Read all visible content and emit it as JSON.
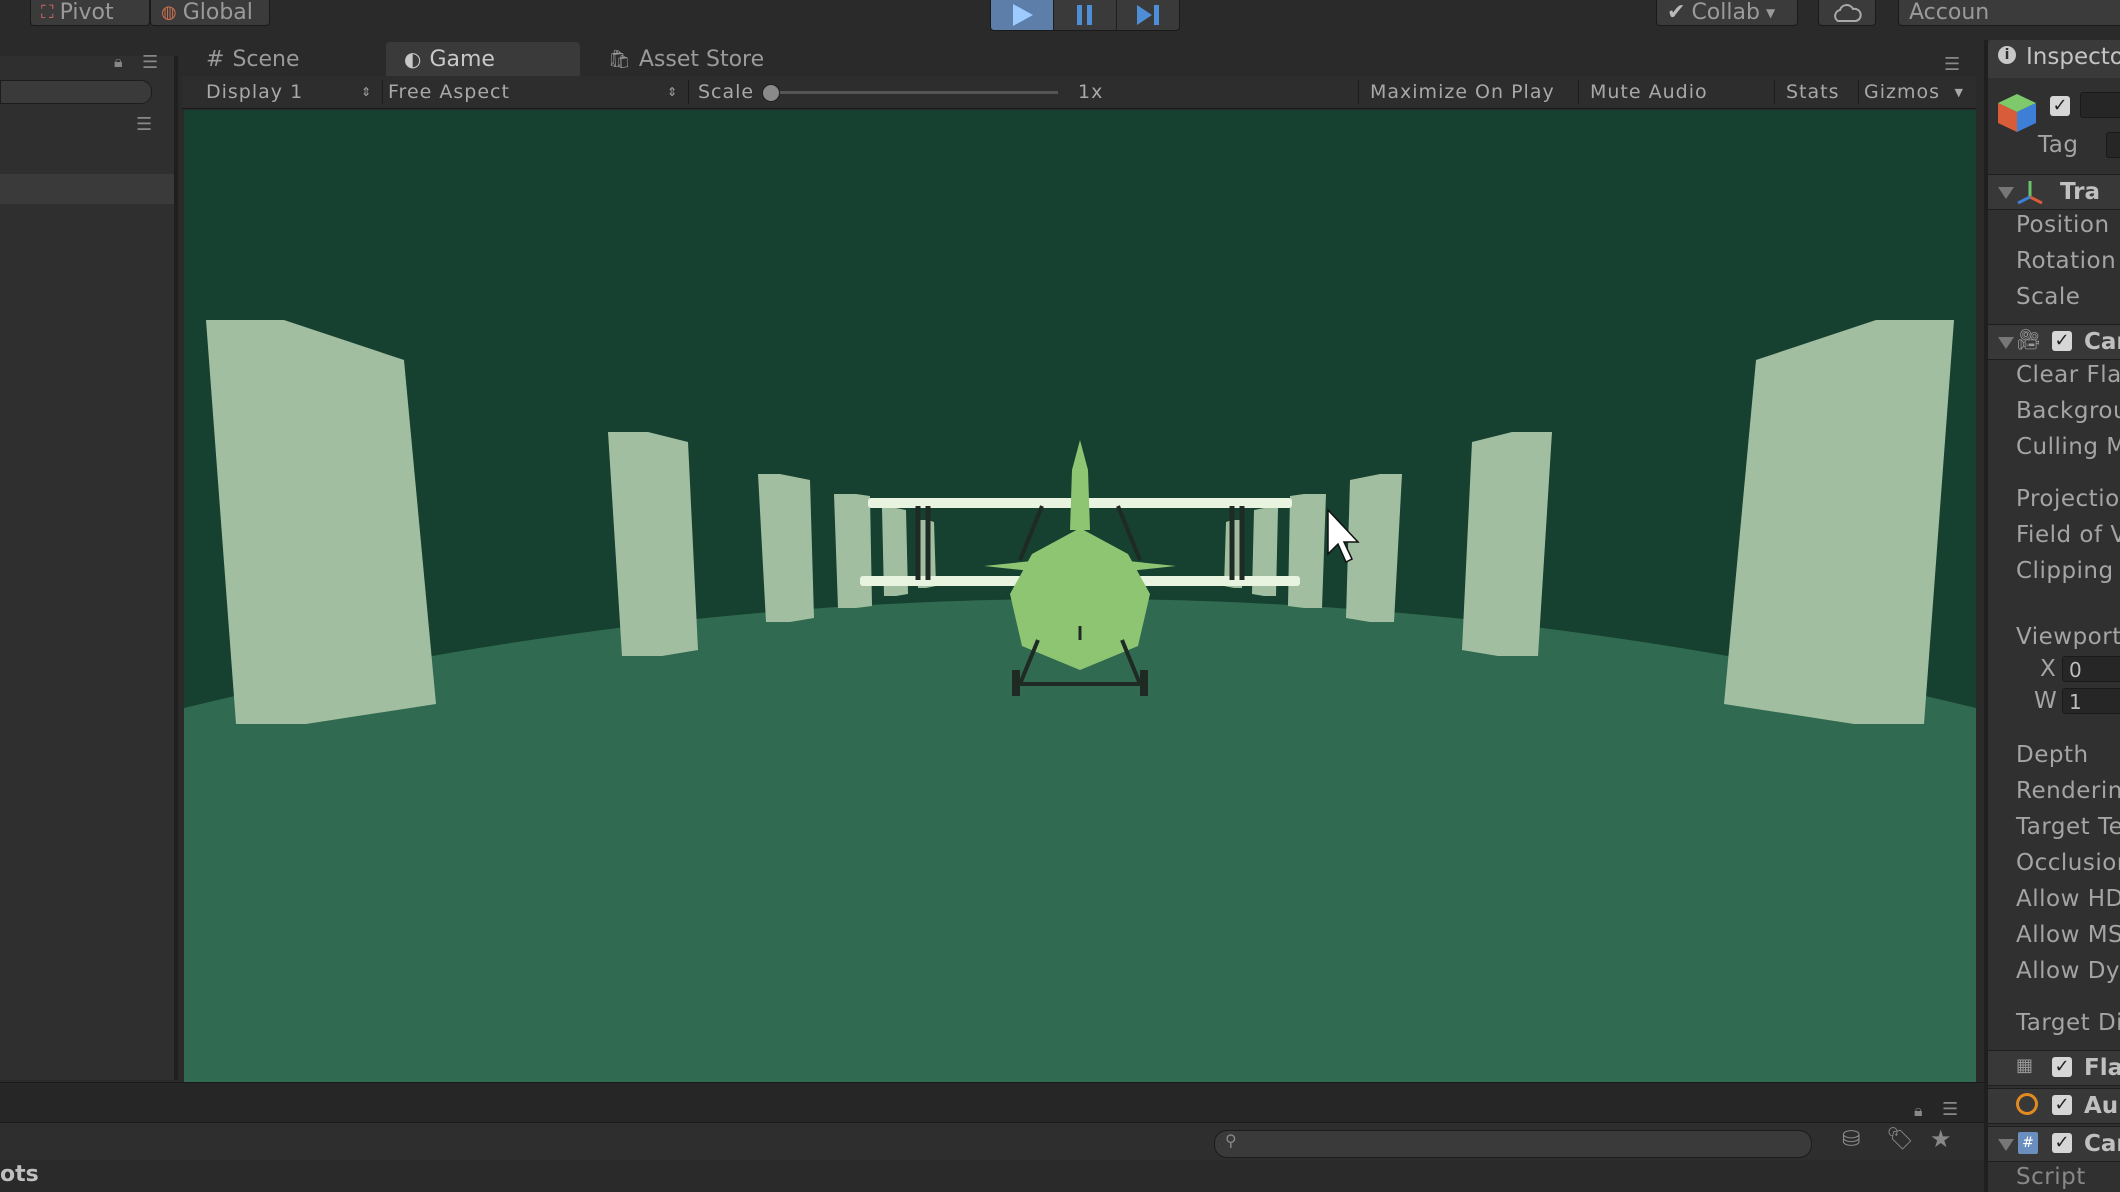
{
  "toolbar": {
    "pivot_label": "Pivot",
    "global_label": "Global",
    "collab_label": "Collab",
    "account_label": "Accoun"
  },
  "tabs": {
    "scene": "Scene",
    "game": "Game",
    "asset_store": "Asset Store"
  },
  "game_toolbar": {
    "display": "Display 1",
    "aspect": "Free Aspect",
    "scale_label": "Scale",
    "scale_value": "1x",
    "maximize_on_play": "Maximize On Play",
    "mute_audio": "Mute Audio",
    "stats": "Stats",
    "gizmos": "Gizmos"
  },
  "inspector": {
    "tab_label": "Inspecto",
    "tag_label": "Tag",
    "transform_title": "Tra",
    "transform_fields": [
      "Position",
      "Rotation",
      "Scale"
    ],
    "camera_title": "Car",
    "camera_fields_a": [
      "Clear Flac",
      "Backgrou",
      "Culling M"
    ],
    "camera_fields_b": [
      "Projectior",
      "Field of V",
      "Clipping F"
    ],
    "viewport_label": "Viewport",
    "viewport_x_label": "X",
    "viewport_x_value": "0",
    "viewport_w_label": "W",
    "viewport_w_value": "1",
    "camera_fields_c": [
      "Depth",
      "Renderinc",
      "Target Te",
      "Occlusion",
      "Allow HDI",
      "Allow MS/",
      "Allow Dyr"
    ],
    "target_display_label": "Target Di",
    "flare_title": "Fla",
    "audio_title": "Au",
    "script_comp_title": "Car",
    "script_label": "Script"
  },
  "bottom": {
    "project_label": "ots"
  },
  "colors": {
    "sky": "#16402f",
    "ground": "#306a50",
    "pillar": "#a2bea0",
    "plane": "#8ec573",
    "wing": "#e8f4e0",
    "play_active": "#5c7ea8"
  }
}
